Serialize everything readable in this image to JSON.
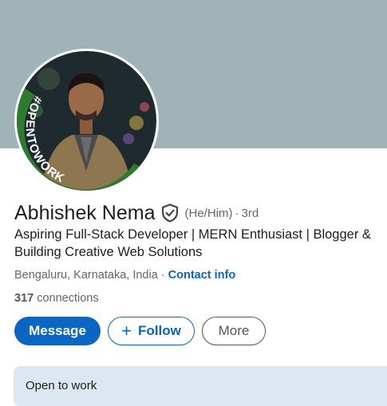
{
  "profile": {
    "name": "Abhishek Nema",
    "pronouns": "(He/Him)",
    "separator": "·",
    "degree": "3rd",
    "headline_line1": "Aspiring Full-Stack Developer | MERN Enthusiast | Blogger &",
    "headline_line2": "Building Creative Web Solutions",
    "location": "Bengaluru, Karnataka, India",
    "location_sep": " · ",
    "contact_info": "Contact info",
    "connections_count": "317",
    "connections_label": " connections",
    "avatar_frame_text": "#OPENTOWORK"
  },
  "actions": {
    "message": "Message",
    "follow_plus": "+",
    "follow": "Follow",
    "more": "More"
  },
  "open_to_work": {
    "title": "Open to work"
  },
  "colors": {
    "cover": "#a0b4b7",
    "primary": "#0a66c2",
    "open_to_work_green": "#2e7a2e",
    "card_bg": "#dde7f1"
  },
  "icons": {
    "verified": "shield-check-icon"
  }
}
